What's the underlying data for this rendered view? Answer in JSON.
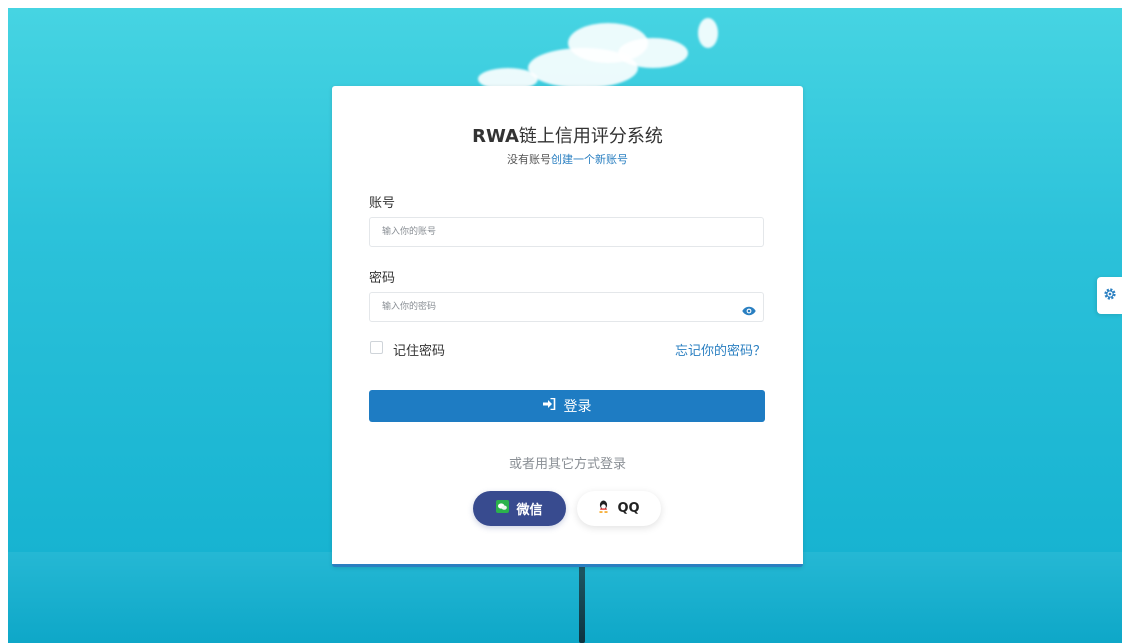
{
  "header": {
    "title_brand": "RWA",
    "title_rest": "链上信用评分系统",
    "no_account_text": "没有账号",
    "create_account_link": "创建一个新账号"
  },
  "form": {
    "account_label": "账号",
    "account_placeholder": "输入你的账号",
    "password_label": "密码",
    "password_placeholder": "输入你的密码",
    "remember_label": "记住密码",
    "forgot_link": "忘记你的密码？",
    "login_button_label": "登录"
  },
  "alt_login": {
    "prompt": "或者用其它方式登录",
    "wechat_label": "微信",
    "qq_label": "QQ"
  },
  "colors": {
    "accent": "#1e7cc3",
    "link": "#2a7fc1",
    "wechat_button": "#384b8f"
  },
  "icons": [
    "eye-icon",
    "sign-in-icon",
    "wechat-icon",
    "qq-icon",
    "gear-icon"
  ]
}
